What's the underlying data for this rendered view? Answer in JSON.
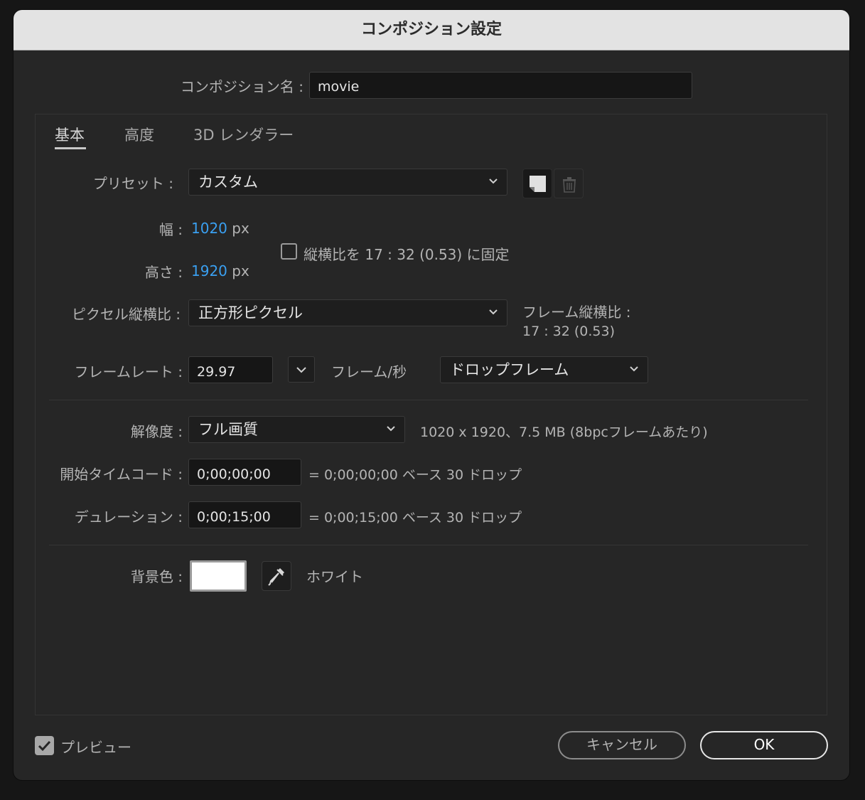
{
  "dialog": {
    "title": "コンポジション設定"
  },
  "comp_name": {
    "label": "コンポジション名 :",
    "value": "movie"
  },
  "tabs": [
    "基本",
    "高度",
    "3D レンダラー"
  ],
  "preset": {
    "label": "プリセット :",
    "value": "カスタム",
    "icons": [
      "save-preset-icon",
      "delete-preset-icon"
    ]
  },
  "size": {
    "width_label": "幅 :",
    "width_value": "1020",
    "width_unit": "px",
    "height_label": "高さ :",
    "height_value": "1920",
    "height_unit": "px",
    "lock_label": "縦横比を 17 : 32 (0.53) に固定",
    "lock_checked": false
  },
  "pixel_aspect": {
    "label": "ピクセル縦横比 :",
    "value": "正方形ピクセル",
    "frame_aspect_label": "フレーム縦横比 :",
    "frame_aspect_value": "17 : 32 (0.53)"
  },
  "frame_rate": {
    "label": "フレームレート :",
    "value": "29.97",
    "unit": "フレーム/秒",
    "drop_value": "ドロップフレーム"
  },
  "resolution": {
    "label": "解像度 :",
    "value": "フル画質",
    "info": "1020 x 1920、7.5 MB (8bpcフレームあたり)"
  },
  "start_timecode": {
    "label": "開始タイムコード :",
    "value": "0;00;00;00",
    "info": "= 0;00;00;00  ベース 30  ドロップ"
  },
  "duration": {
    "label": "デュレーション :",
    "value": "0;00;15;00",
    "info": "= 0;00;15;00  ベース 30  ドロップ"
  },
  "background": {
    "label": "背景色 :",
    "color": "#ffffff",
    "name": "ホワイト"
  },
  "footer": {
    "preview_label": "プレビュー",
    "preview_checked": true,
    "cancel": "キャンセル",
    "ok": "OK"
  },
  "colors": {
    "accent": "#3aa0f1",
    "dialog_bg": "#262626",
    "titlebar_bg": "#e3e3e3"
  }
}
